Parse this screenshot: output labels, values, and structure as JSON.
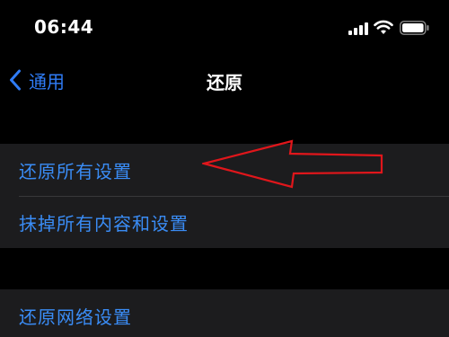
{
  "status_bar": {
    "time": "06:44",
    "signal_icon": "cellular-signal-icon",
    "wifi_icon": "wifi-icon",
    "battery_icon": "battery-icon"
  },
  "nav": {
    "back_label": "通用",
    "back_icon": "chevron-back-icon",
    "title": "还原"
  },
  "groups": [
    {
      "items": [
        {
          "label": "还原所有设置"
        },
        {
          "label": "抹掉所有内容和设置"
        }
      ]
    },
    {
      "items": [
        {
          "label": "还原网络设置"
        }
      ]
    }
  ],
  "annotation": {
    "icon": "red-arrow-outline",
    "color": "#e0161b"
  },
  "colors": {
    "background": "#000000",
    "cell_background": "#1c1c1e",
    "accent": "#2f7cf6",
    "separator": "#38383a"
  }
}
